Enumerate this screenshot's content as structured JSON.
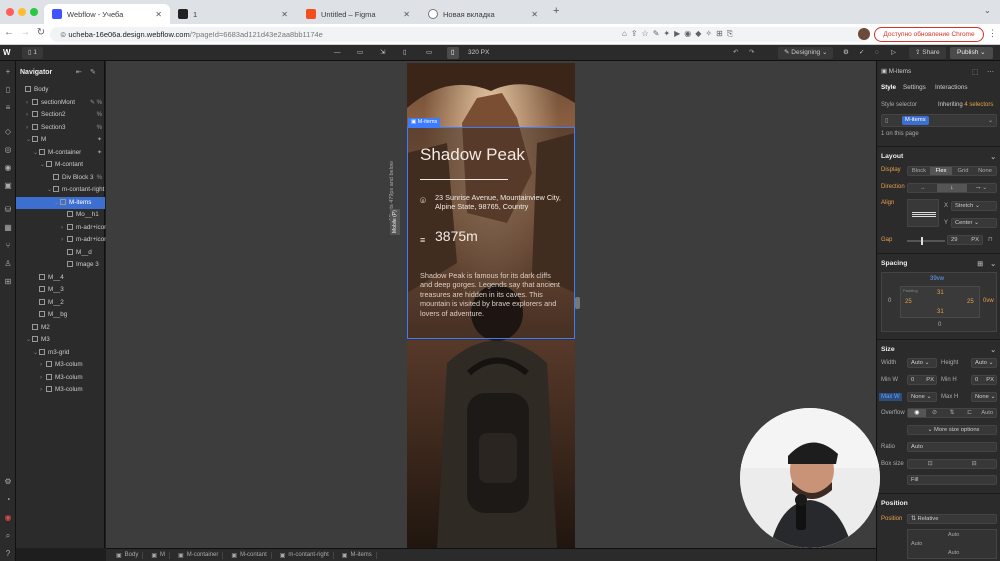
{
  "browser": {
    "tabs": [
      {
        "label": "Webflow - Учеба",
        "active": true
      },
      {
        "label": "1",
        "active": false
      },
      {
        "label": "Untitled – Figma",
        "active": false
      },
      {
        "label": "Новая вкладка",
        "active": false
      }
    ],
    "url_host": "ucheba-16e06a.design.webflow.com",
    "url_path": "/?pageId=6683ad121d43e2aa8bb1174e",
    "update_button": "Доступно обновление Chrome"
  },
  "toolbar": {
    "page_badge": "1",
    "width_readout": "320 PX",
    "mode": "Designing",
    "share": "Share",
    "publish": "Publish"
  },
  "navigator": {
    "title": "Navigator",
    "items": [
      {
        "label": "Body",
        "indent": 0,
        "caret": ""
      },
      {
        "label": "sectionMont",
        "indent": 1,
        "caret": "›",
        "flag": "✎ %"
      },
      {
        "label": "Section2",
        "indent": 1,
        "caret": "›",
        "flag": "%"
      },
      {
        "label": "Section3",
        "indent": 1,
        "caret": "›",
        "flag": "%"
      },
      {
        "label": "M",
        "indent": 1,
        "caret": "⌄",
        "flag": "✦"
      },
      {
        "label": "M-container",
        "indent": 2,
        "caret": "⌄",
        "flag": "✦"
      },
      {
        "label": "M-contant",
        "indent": 3,
        "caret": "⌄"
      },
      {
        "label": "Div Block 3",
        "indent": 4,
        "caret": "",
        "flag": "%"
      },
      {
        "label": "m-contant-right",
        "indent": 4,
        "caret": "⌄"
      },
      {
        "label": "M-items",
        "indent": 5,
        "caret": "⌄",
        "selected": true
      },
      {
        "label": "Mo__h1",
        "indent": 6,
        "caret": ""
      },
      {
        "label": "m-adr+icon",
        "indent": 6,
        "caret": "›"
      },
      {
        "label": "m-adr+icon",
        "indent": 6,
        "caret": "›"
      },
      {
        "label": "M__d",
        "indent": 6,
        "caret": ""
      },
      {
        "label": "Image 3",
        "indent": 6,
        "caret": ""
      },
      {
        "label": "M__4",
        "indent": 2,
        "caret": ""
      },
      {
        "label": "M__3",
        "indent": 2,
        "caret": ""
      },
      {
        "label": "M__2",
        "indent": 2,
        "caret": ""
      },
      {
        "label": "M__bg",
        "indent": 2,
        "caret": ""
      },
      {
        "label": "M2",
        "indent": 1,
        "caret": ""
      },
      {
        "label": "M3",
        "indent": 1,
        "caret": "⌄"
      },
      {
        "label": "m3-grid",
        "indent": 2,
        "caret": "⌄"
      },
      {
        "label": "M3-colum",
        "indent": 3,
        "caret": "›"
      },
      {
        "label": "M3-colum",
        "indent": 3,
        "caret": "›"
      },
      {
        "label": "M3-colum",
        "indent": 3,
        "caret": "›"
      }
    ]
  },
  "canvas": {
    "side_label": "Affects 479px and below",
    "mobile_tag": "Mobile (P)",
    "element_tag": "M-items",
    "heading": "Shadow Peak",
    "address": "23 Sunrise Avenue, Mountainview City, Alpine State, 98765, Country",
    "height_value": "3875m",
    "description": "Shadow Peak is famous for its dark cliffs and deep gorges. Legends say that ancient treasures are hidden in its caves. This mountain is visited by brave explorers and lovers of adventure."
  },
  "breadcrumbs": [
    "Body",
    "M",
    "M-container",
    "M-contant",
    "m-contant-right",
    "M-items"
  ],
  "right_panel": {
    "element_name": "M-items",
    "tabs": [
      "Style",
      "Settings",
      "Interactions"
    ],
    "style_selector_label": "Style selector",
    "inheriting": "Inheriting",
    "inheriting_count": "4 selectors",
    "selector_chip": "M-items",
    "on_this_page": "1 on this page",
    "layout": {
      "title": "Layout",
      "display_label": "Display",
      "display_options": [
        "Block",
        "Flex",
        "Grid",
        "None"
      ],
      "direction_label": "Direction",
      "align_label": "Align",
      "x_label": "X",
      "x_value": "Stretch",
      "y_label": "Y",
      "y_value": "Center",
      "gap_label": "Gap",
      "gap_value": "29",
      "gap_unit": "PX"
    },
    "spacing": {
      "title": "Spacing",
      "margin_top": "39vw",
      "margin_left": "0",
      "margin_right": "0vw",
      "margin_bottom": "0",
      "padding_label": "Padding",
      "padding_top": "31",
      "padding_left": "25",
      "padding_right": "25",
      "padding_bottom": "31"
    },
    "size": {
      "title": "Size",
      "width_label": "Width",
      "width_value": "Auto",
      "height_label": "Height",
      "height_value": "Auto",
      "minw_label": "Min W",
      "minw_value": "0",
      "minw_unit": "PX",
      "minh_label": "Min H",
      "minh_value": "0",
      "minh_unit": "PX",
      "maxw_label": "Max W",
      "maxw_value": "None",
      "maxh_label": "Max H",
      "maxh_value": "None",
      "overflow_label": "Overflow",
      "overflow_auto": "Auto",
      "more_options": "More size options",
      "ratio_label": "Ratio",
      "ratio_value": "Auto",
      "boxsize_label": "Box size",
      "fit_value": "Fill"
    },
    "position": {
      "title": "Position",
      "label": "Position",
      "value": "Relative",
      "auto_top": "Auto",
      "auto_left": "Auto",
      "auto_bottom": "Auto"
    }
  }
}
